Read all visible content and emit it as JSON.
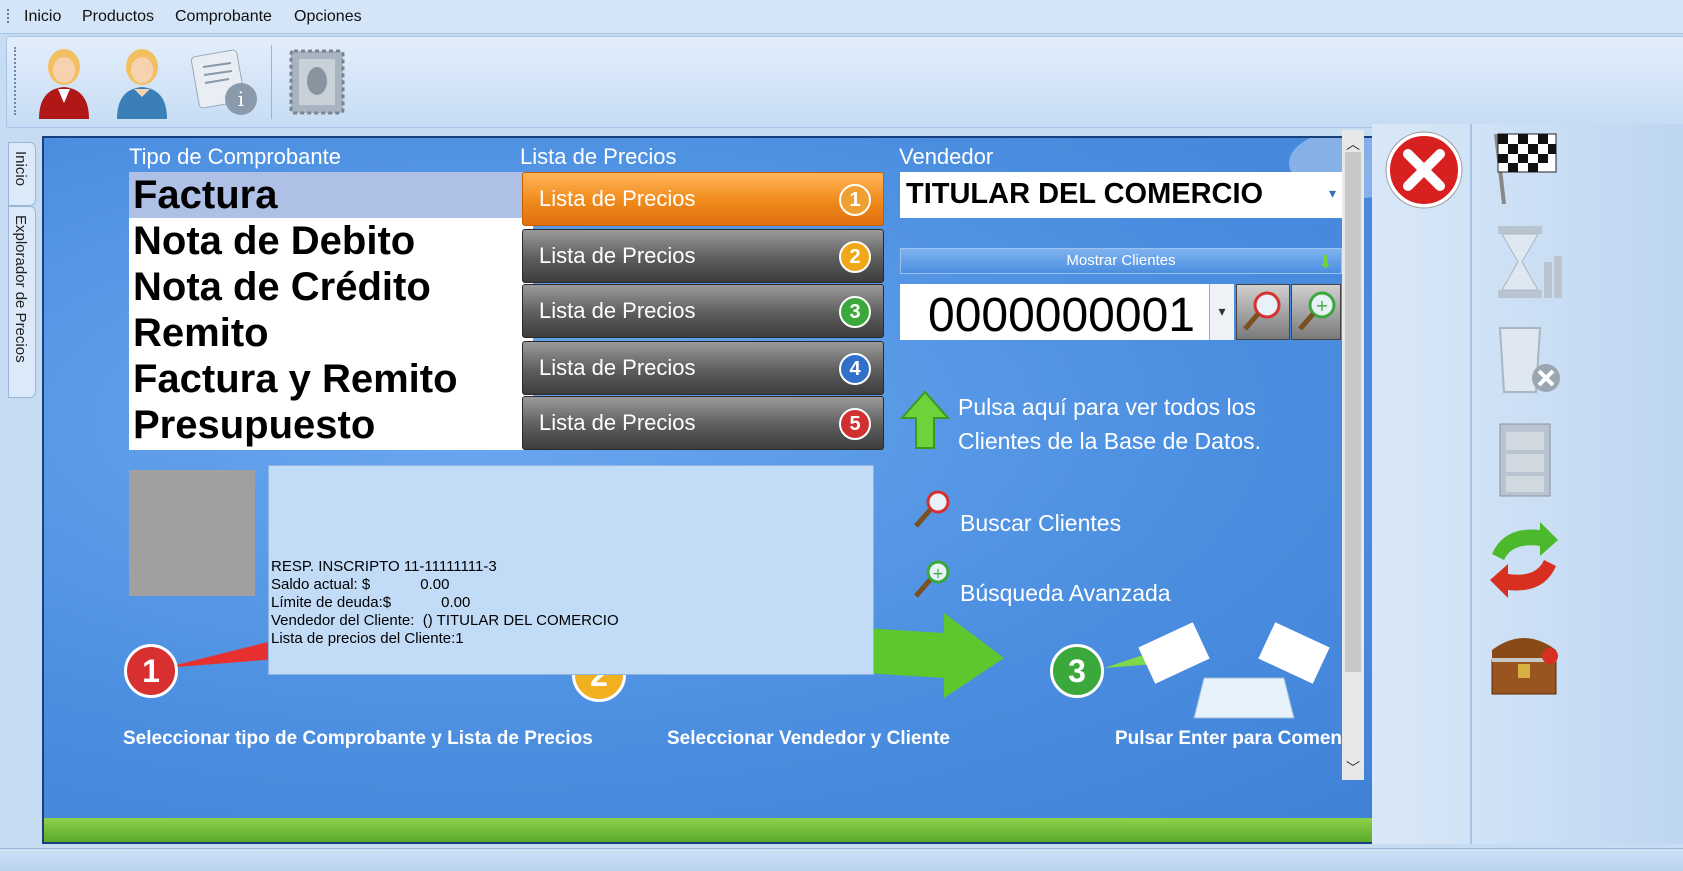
{
  "menu": {
    "items": [
      "Inicio",
      "Productos",
      "Comprobante",
      "Opciones"
    ]
  },
  "toolbar": {
    "icons": [
      "vendedor-icon",
      "cliente-icon",
      "info-icon",
      "stamp-icon"
    ]
  },
  "side_tabs": {
    "inicio": "Inicio",
    "explorador": "Explorador de Precios"
  },
  "labels": {
    "tipo": "Tipo de Comprobante",
    "lista": "Lista de Precios",
    "vendedor": "Vendedor"
  },
  "tipo_comprobante": {
    "selected": "Factura",
    "items": [
      "Factura",
      "Nota de Debito",
      "Nota de Crédito",
      "Remito",
      "Factura y Remito",
      "Presupuesto"
    ]
  },
  "listas": [
    {
      "label": "Lista de Precios",
      "num": "1",
      "color": "#f0a030",
      "selected": true
    },
    {
      "label": "Lista de Precios",
      "num": "2",
      "color": "#f0a818"
    },
    {
      "label": "Lista de Precios",
      "num": "3",
      "color": "#3aa83a"
    },
    {
      "label": "Lista de Precios",
      "num": "4",
      "color": "#3070c8"
    },
    {
      "label": "Lista de Precios",
      "num": "5",
      "color": "#d03030"
    }
  ],
  "vendedor": {
    "value": "TITULAR DEL COMERCIO"
  },
  "mostrar_clientes": "Mostrar Clientes",
  "cliente": {
    "value": "0000000001"
  },
  "hint": {
    "line1": "Pulsa aquí para ver todos los",
    "line2": "Clientes de la Base de Datos."
  },
  "actions": {
    "buscar": "Buscar Clientes",
    "avanzada": "Búsqueda Avanzada"
  },
  "cliente_info": {
    "line1": "RESP. INSCRIPTO 11-11111111-3",
    "line2": "Saldo actual: $            0.00",
    "line3": "Límite de deuda:$            0.00",
    "line4": "Vendedor del Cliente:  () TITULAR DEL COMERCIO",
    "line5": "Lista de precios del Cliente:1"
  },
  "steps": {
    "s1": "Seleccionar tipo de Comprobante y Lista de Precios",
    "s2": "Seleccionar Vendedor y Cliente",
    "s3": "Pulsar Enter para Comenza",
    "n1": "1",
    "n2": "2",
    "n3": "3"
  },
  "right_panel": {
    "icons": [
      "close-icon",
      "checkered-flag-icon",
      "hourglass-icon",
      "recycle-bin-icon",
      "file-cabinet-icon",
      "refresh-icon",
      "treasure-chest-icon"
    ]
  }
}
